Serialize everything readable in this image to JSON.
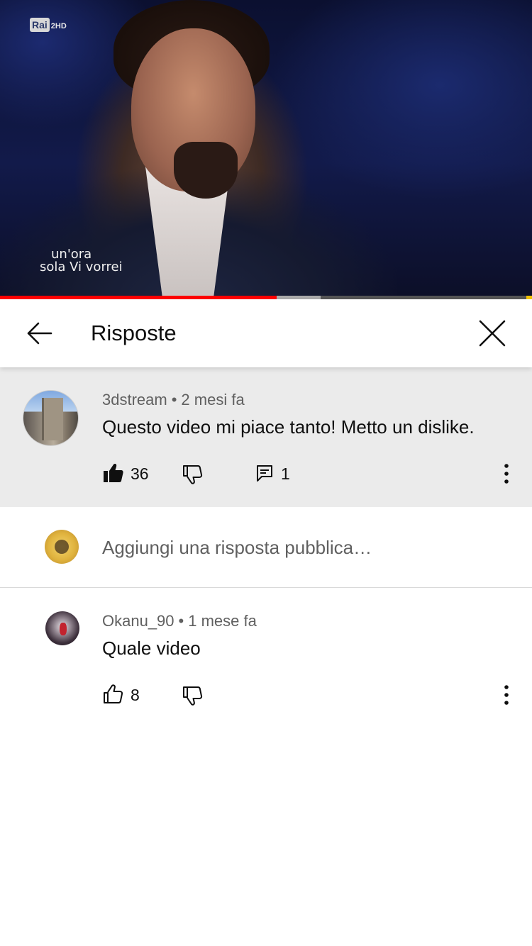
{
  "video": {
    "channel_logo_main": "Rai",
    "channel_logo_sub": "2HD",
    "show_logo_line1": "un'ora",
    "show_logo_line2": "sola Vi vorrei",
    "progress_played_fraction": 0.52,
    "progress_buffered_fraction": 0.603
  },
  "header": {
    "title": "Risposte",
    "back_icon": "arrow-left-icon",
    "close_icon": "close-icon"
  },
  "parent_comment": {
    "author": "3dstream",
    "separator": "•",
    "time": "2 mesi fa",
    "text": "Questo video mi piace tanto! Metto un dislike.",
    "likes": "36",
    "replies": "1",
    "like_icon": "thumbs-up-filled-icon",
    "dislike_icon": "thumbs-down-icon",
    "reply_icon": "comment-icon",
    "more_icon": "more-vertical-icon"
  },
  "reply_box": {
    "placeholder": "Aggiungi una risposta pubblica…",
    "value": ""
  },
  "replies": [
    {
      "author": "Okanu_90",
      "separator": "•",
      "time": "1 mese fa",
      "text": "Quale video",
      "likes": "8",
      "like_icon": "thumbs-up-icon",
      "dislike_icon": "thumbs-down-icon",
      "more_icon": "more-vertical-icon"
    }
  ],
  "colors": {
    "progress_played": "#ff0000",
    "progress_buffered": "#aaaaaa",
    "highlight_bg": "#ebebeb",
    "text_primary": "#0f0f0f",
    "text_secondary": "#606060"
  }
}
